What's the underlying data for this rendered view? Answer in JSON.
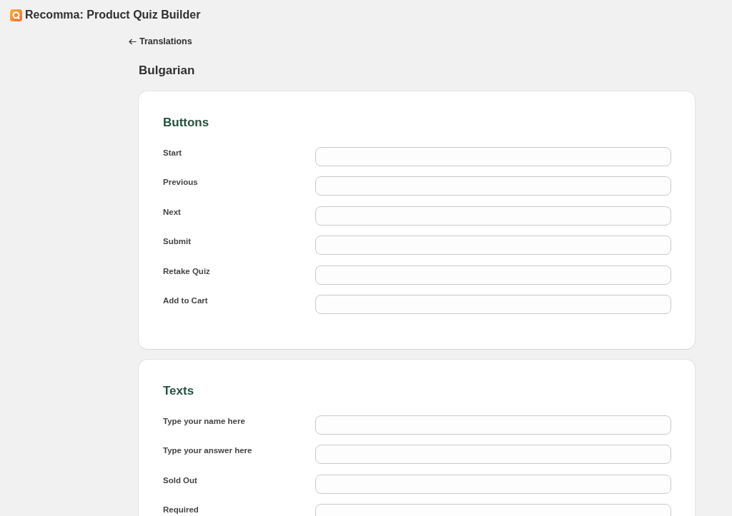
{
  "app": {
    "title": "Recomma: Product Quiz Builder"
  },
  "back_link": {
    "label": "Translations"
  },
  "page_title": "Bulgarian",
  "sections": [
    {
      "title": "Buttons",
      "fields": [
        {
          "label": "Start"
        },
        {
          "label": "Previous"
        },
        {
          "label": "Next"
        },
        {
          "label": "Submit"
        },
        {
          "label": "Retake Quiz"
        },
        {
          "label": "Add to Cart"
        }
      ]
    },
    {
      "title": "Texts",
      "fields": [
        {
          "label": "Type your name here"
        },
        {
          "label": "Type your answer here"
        },
        {
          "label": "Sold Out"
        },
        {
          "label": "Required"
        }
      ]
    }
  ]
}
